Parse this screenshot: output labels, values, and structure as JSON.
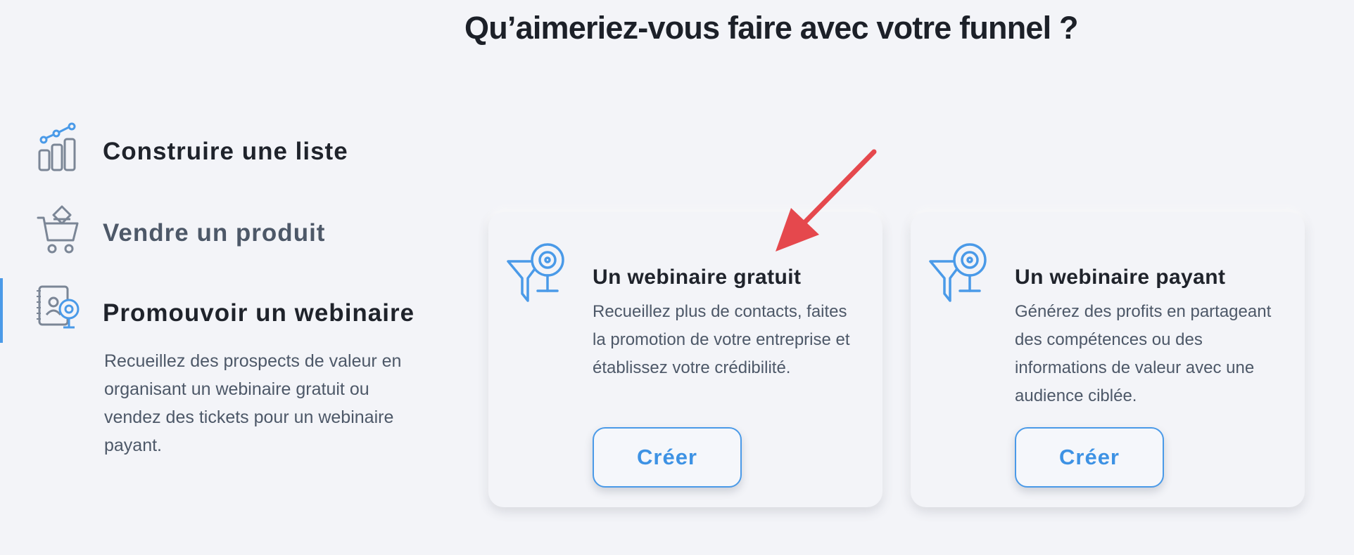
{
  "headline": "Qu’aimeriez-vous faire avec votre funnel ?",
  "menu": {
    "items": [
      {
        "label": "Construire une liste",
        "icon": "bar-chart-growth-icon"
      },
      {
        "label": "Vendre un produit",
        "icon": "shopping-cart-icon"
      },
      {
        "label": "Promouvoir un webinaire",
        "icon": "webinar-notebook-icon",
        "active": true
      }
    ],
    "active_description": "Recueillez des prospects de valeur en organisant un webinaire gratuit ou vendez des tickets pour un webinaire payant."
  },
  "cards": [
    {
      "title": "Un webinaire gratuit",
      "description": "Recueillez plus de contacts, faites la promotion de votre entreprise et établissez votre crédibilité.",
      "button_label": "Créer",
      "icon": "funnel-webcam-icon"
    },
    {
      "title": "Un webinaire payant",
      "description": "Générez des profits en partageant des compétences ou des informations de valeur avec une audience ciblée.",
      "button_label": "Créer",
      "icon": "funnel-webcam-icon"
    }
  ],
  "colors": {
    "accent": "#4a9ae8",
    "annotation_arrow": "#e5484d",
    "background": "#f3f4f8",
    "text_dark": "#1f232b",
    "text_muted": "#4d5868"
  }
}
